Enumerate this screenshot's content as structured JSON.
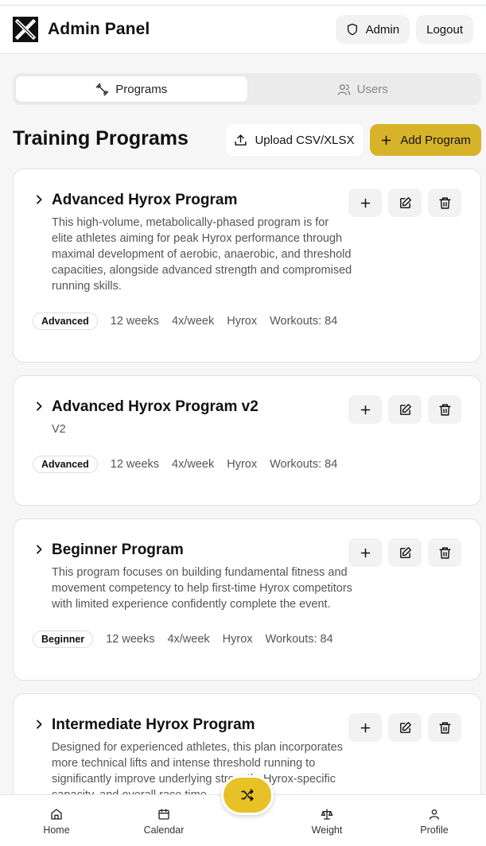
{
  "header": {
    "title": "Admin Panel",
    "admin_label": "Admin",
    "logout_label": "Logout"
  },
  "tabs": [
    {
      "label": "Programs",
      "active": true
    },
    {
      "label": "Users",
      "active": false
    }
  ],
  "section": {
    "title": "Training Programs",
    "upload_label": "Upload CSV/XLSX",
    "add_label": "Add Program"
  },
  "programs": [
    {
      "title": "Advanced Hyrox Program",
      "description": "This high-volume, metabolically-phased program is for elite athletes aiming for peak Hyrox performance through maximal development of aerobic, anaerobic, and threshold capacities, alongside advanced strength and compromised running skills.",
      "level": "Advanced",
      "duration": "12 weeks",
      "frequency": "4x/week",
      "category": "Hyrox",
      "workouts": "Workouts: 84"
    },
    {
      "title": "Advanced Hyrox Program v2",
      "description": "V2",
      "level": "Advanced",
      "duration": "12 weeks",
      "frequency": "4x/week",
      "category": "Hyrox",
      "workouts": "Workouts: 84"
    },
    {
      "title": "Beginner Program",
      "description": "This program focuses on building fundamental fitness and movement competency to help first-time Hyrox competitors with limited experience confidently complete the event.",
      "level": "Beginner",
      "duration": "12 weeks",
      "frequency": "4x/week",
      "category": "Hyrox",
      "workouts": "Workouts: 84"
    },
    {
      "title": "Intermediate Hyrox Program",
      "description": "Designed for experienced athletes, this plan incorporates more technical lifts and intense threshold running to significantly improve underlying strength, Hyrox-specific capacity, and overall race time."
    }
  ],
  "bottom_nav": [
    {
      "label": "Home",
      "icon": "home-icon"
    },
    {
      "label": "Calendar",
      "icon": "calendar-icon"
    },
    {
      "label": "Weight",
      "icon": "scale-icon"
    },
    {
      "label": "Profile",
      "icon": "user-icon"
    }
  ],
  "colors": {
    "accent": "#d7b32a",
    "fab": "#e7c227"
  }
}
